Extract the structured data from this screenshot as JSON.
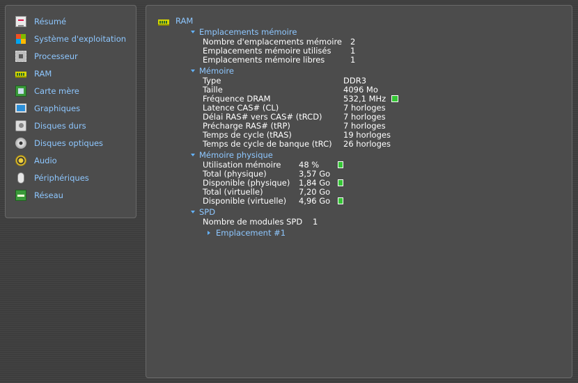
{
  "sidebar": {
    "items": [
      {
        "label": "Résumé",
        "icon": "resume-icon"
      },
      {
        "label": "Système d'exploitation",
        "icon": "windows-logo-icon"
      },
      {
        "label": "Processeur",
        "icon": "cpu-icon"
      },
      {
        "label": "RAM",
        "icon": "ram-icon"
      },
      {
        "label": "Carte mère",
        "icon": "motherboard-icon"
      },
      {
        "label": "Graphiques",
        "icon": "monitor-icon"
      },
      {
        "label": "Disques durs",
        "icon": "hard-drive-icon"
      },
      {
        "label": "Disques optiques",
        "icon": "optical-disc-icon"
      },
      {
        "label": "Audio",
        "icon": "speaker-icon"
      },
      {
        "label": "Périphériques",
        "icon": "mouse-icon"
      },
      {
        "label": "Réseau",
        "icon": "network-icon"
      }
    ]
  },
  "main": {
    "title": "RAM",
    "title_icon": "ram-icon",
    "sections": {
      "slots": {
        "title": "Emplacements mémoire",
        "rows": [
          {
            "key": "Nombre d'emplacements mémoire",
            "value": "2"
          },
          {
            "key": "Emplacements mémoire utilisés",
            "value": "1"
          },
          {
            "key": "Emplacements mémoire libres",
            "value": "1"
          }
        ]
      },
      "memory": {
        "title": "Mémoire",
        "rows": [
          {
            "key": "Type",
            "value": "DDR3"
          },
          {
            "key": "Taille",
            "value": "4096 Mo"
          },
          {
            "key": "Fréquence DRAM",
            "value": "532,1 MHz"
          },
          {
            "key": "Latence CAS# (CL)",
            "value": "7 horloges"
          },
          {
            "key": "Délai RAS# vers CAS# (tRCD)",
            "value": "7 horloges"
          },
          {
            "key": "Précharge RAS# (tRP)",
            "value": "7 horloges"
          },
          {
            "key": "Temps de cycle (tRAS)",
            "value": "19 horloges"
          },
          {
            "key": "Temps de cycle de banque (tRC)",
            "value": "26 horloges"
          }
        ]
      },
      "physical": {
        "title": "Mémoire physique",
        "rows": [
          {
            "key": "Utilisation mémoire",
            "value": "48 %"
          },
          {
            "key": "Total (physique)",
            "value": "3,57 Go"
          },
          {
            "key": "Disponible (physique)",
            "value": "1,84 Go"
          },
          {
            "key": "Total (virtuelle)",
            "value": "7,20 Go"
          },
          {
            "key": "Disponible (virtuelle)",
            "value": "4,96 Go"
          }
        ]
      },
      "spd": {
        "title": "SPD",
        "rows": [
          {
            "key": "Nombre de modules SPD",
            "value": "1"
          }
        ],
        "child": "Emplacement #1"
      }
    },
    "indicator_color": "#35c635",
    "accent_color": "#8ec7ff"
  }
}
